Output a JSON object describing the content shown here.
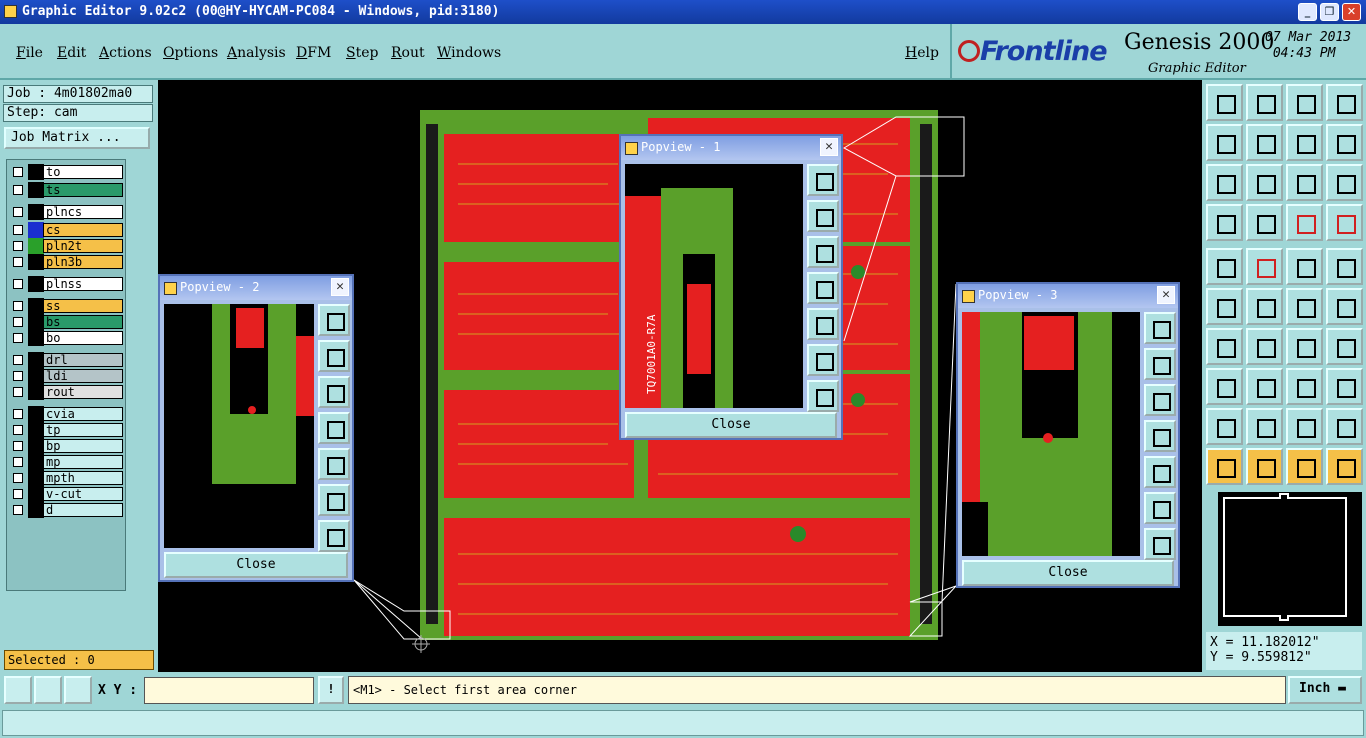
{
  "window": {
    "title": "Graphic Editor 9.02c2 (00@HY-HYCAM-PC084 - Windows, pid:3180)"
  },
  "menu": [
    "File",
    "Edit",
    "Actions",
    "Options",
    "Analysis",
    "DFM",
    "Step",
    "Rout",
    "Windows"
  ],
  "help": "Help",
  "brand": {
    "logo": "Frontline",
    "product": "Genesis 2000",
    "subtitle": "Graphic Editor",
    "date": "07 Mar 2013",
    "time": "04:43 PM"
  },
  "job": {
    "job": "Job : 4m01802ma0",
    "step": "Step: cam",
    "matrix_button": "Job Matrix ..."
  },
  "layers": [
    {
      "name": "to",
      "color": "#ffffff",
      "sw": "#000000",
      "mark": "⬋"
    },
    {
      "name": "ts",
      "color": "#2a9a6a",
      "sw": "#000000",
      "mark": "⬋"
    },
    {
      "name": "plncs",
      "color": "#ffffff",
      "sw": "#000000",
      "mark": ""
    },
    {
      "name": "cs",
      "color": "#f5c048",
      "sw": "#1a2fd0",
      "mark": "⬋ ⊞"
    },
    {
      "name": "pln2t",
      "color": "#f5c048",
      "sw": "#2aa02a",
      "mark": "⬋"
    },
    {
      "name": "pln3b",
      "color": "#f5c048",
      "sw": "#000000",
      "mark": "⬋"
    },
    {
      "name": "plnss",
      "color": "#ffffff",
      "sw": "#000000",
      "mark": ""
    },
    {
      "name": "ss",
      "color": "#f5c048",
      "sw": "#000000",
      "mark": "⬋"
    },
    {
      "name": "bs",
      "color": "#2a9a6a",
      "sw": "#000000",
      "mark": "⬋"
    },
    {
      "name": "bo",
      "color": "#ffffff",
      "sw": "#000000",
      "mark": "⬋"
    },
    {
      "name": "drl",
      "color": "#b4c4c8",
      "sw": "#000000",
      "mark": ""
    },
    {
      "name": "ldi",
      "color": "#b4c4c8",
      "sw": "#000000",
      "mark": ""
    },
    {
      "name": "rout",
      "color": "#e0e0e0",
      "sw": "#000000",
      "mark": ""
    },
    {
      "name": "cvia",
      "color": "#c8eeee",
      "sw": "#000000",
      "mark": ""
    },
    {
      "name": "tp",
      "color": "#c8eeee",
      "sw": "#000000",
      "mark": ""
    },
    {
      "name": "bp",
      "color": "#c8eeee",
      "sw": "#000000",
      "mark": ""
    },
    {
      "name": "mp",
      "color": "#c8eeee",
      "sw": "#000000",
      "mark": ""
    },
    {
      "name": "mpth",
      "color": "#c8eeee",
      "sw": "#000000",
      "mark": ""
    },
    {
      "name": "v-cut",
      "color": "#c8eeee",
      "sw": "#000000",
      "mark": ""
    },
    {
      "name": "d",
      "color": "#c8eeee",
      "sw": "#000000",
      "mark": ""
    }
  ],
  "selected": "Selected : 0",
  "popviews": [
    {
      "title": "Popview - 1",
      "close": "Close"
    },
    {
      "title": "Popview - 2",
      "close": "Close"
    },
    {
      "title": "Popview - 3",
      "close": "Close"
    }
  ],
  "board_label": "TQ7001A0-R7A",
  "coords": {
    "x": "X = 11.182012\"",
    "y": "Y = 9.559812\""
  },
  "bottom": {
    "xy_label": "X Y :",
    "xy_value": "",
    "prompt": "<M1> - Select first area corner",
    "unit": "Inch"
  },
  "colors": {
    "panel_bg": "#9fd6d6",
    "copper": "#e52020",
    "mask": "#5aa02a"
  }
}
